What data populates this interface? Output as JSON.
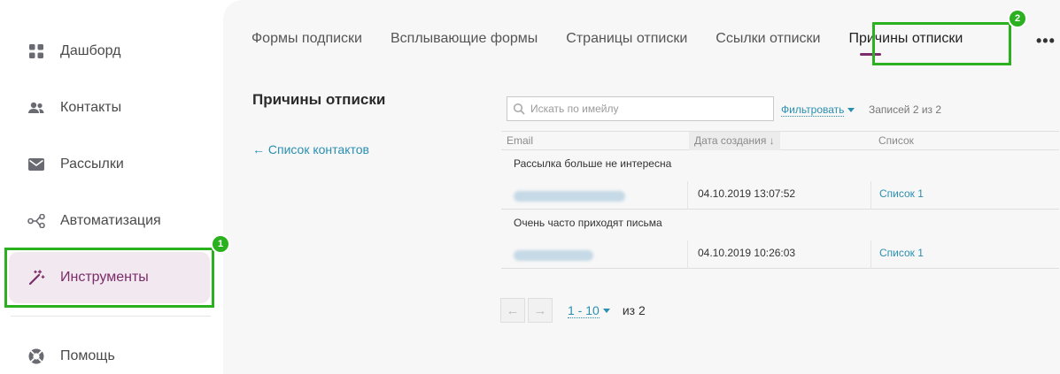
{
  "sidebar": {
    "items": [
      {
        "label": "Дашборд",
        "icon": "grid-icon"
      },
      {
        "label": "Контакты",
        "icon": "users-icon"
      },
      {
        "label": "Рассылки",
        "icon": "mail-icon"
      },
      {
        "label": "Автоматизация",
        "icon": "workflow-icon"
      },
      {
        "label": "Инструменты",
        "icon": "magic-wand-icon",
        "active": true
      },
      {
        "label": "Помощь",
        "icon": "lifebuoy-icon"
      }
    ]
  },
  "tabs": [
    {
      "label": "Формы подписки"
    },
    {
      "label": "Всплывающие формы"
    },
    {
      "label": "Страницы отписки"
    },
    {
      "label": "Ссылки отписки"
    },
    {
      "label": "Причины отписки",
      "active": true
    }
  ],
  "more_label": "•••",
  "page": {
    "title": "Причины отписки",
    "back_link": "← Список контактов"
  },
  "search": {
    "placeholder": "Искать по имейлу"
  },
  "filter_label": "Фильтровать",
  "records_label": "Записей 2 из 2",
  "table": {
    "headers": {
      "email": "Email",
      "date": "Дата создания ↓",
      "list": "Список"
    },
    "rows": [
      {
        "reason": "Рассылка больше не интересна",
        "date": "04.10.2019 13:07:52",
        "list": "Список 1"
      },
      {
        "reason": "Очень часто приходят письма",
        "date": "04.10.2019 10:26:03",
        "list": "Список 1"
      }
    ]
  },
  "pager": {
    "prev": "←",
    "next": "→",
    "range": "1 - 10",
    "of": "из 2"
  },
  "annotations": {
    "badge1": "1",
    "badge2": "2"
  },
  "colors": {
    "accent": "#7b2c6a",
    "link": "#2a8fb0",
    "highlight": "#2bb01f"
  }
}
